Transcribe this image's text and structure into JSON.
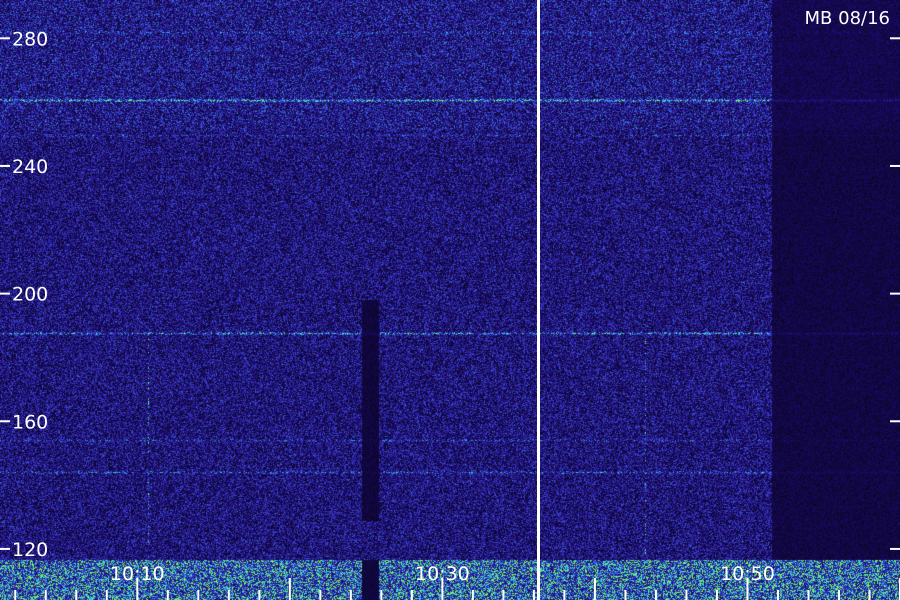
{
  "chart_data": {
    "type": "heatmap",
    "title": "MB 08/16",
    "y_ticks": [
      {
        "value": 280,
        "label": "280"
      },
      {
        "value": 240,
        "label": "240"
      },
      {
        "value": 200,
        "label": "200"
      },
      {
        "value": 160,
        "label": "160"
      },
      {
        "value": 120,
        "label": "120"
      }
    ],
    "x_ticks": [
      {
        "value": "10:10",
        "label": "10:10"
      },
      {
        "value": "10:30",
        "label": "10:30"
      },
      {
        "value": "10:50",
        "label": "10:50"
      }
    ],
    "ylim": [
      104,
      292
    ],
    "xlim": [
      "10:01",
      "11:00"
    ],
    "colors": {
      "background": "#0a0520",
      "signal_low": "#1a0a6a",
      "signal_mid": "#3b3bd0",
      "signal_high": "#2ad0ff",
      "intense": "#7cff4a",
      "axis": "#ffffff"
    }
  }
}
